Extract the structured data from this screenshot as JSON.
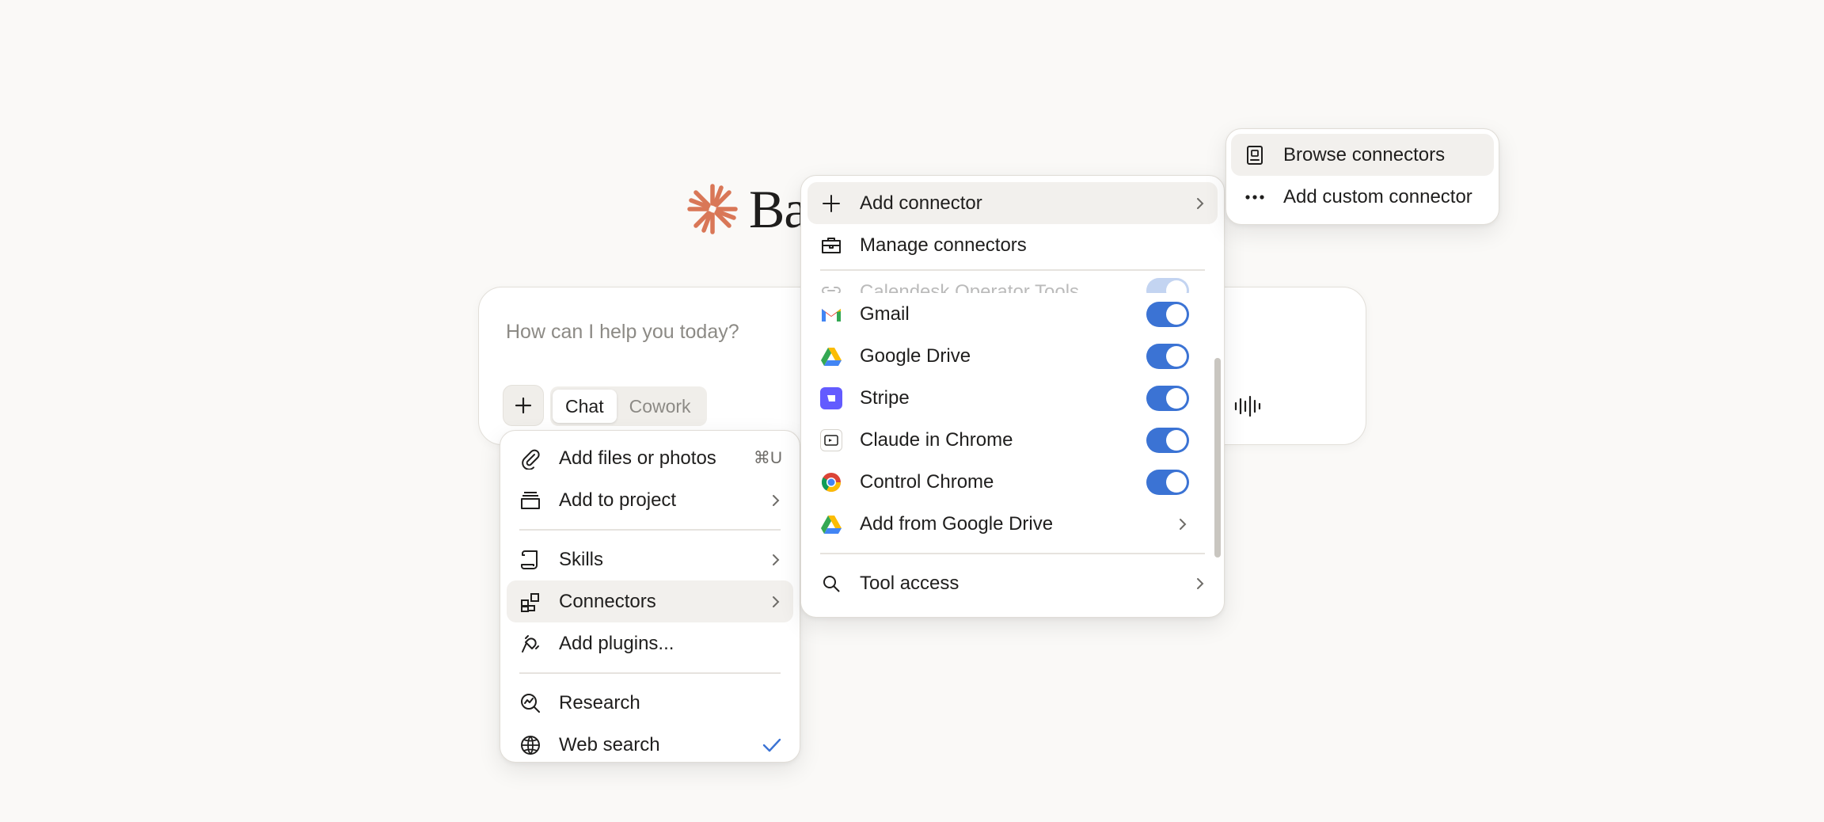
{
  "greeting": {
    "text": "Ba"
  },
  "composer": {
    "placeholder": "How can I help you today?",
    "modes": [
      "Chat",
      "Cowork"
    ]
  },
  "main_menu": {
    "items": [
      {
        "label": "Add files or photos",
        "shortcut": "⌘U",
        "icon": "paperclip-icon"
      },
      {
        "label": "Add to project",
        "icon": "project-box-icon"
      },
      {
        "label": "Skills",
        "icon": "scroll-icon"
      },
      {
        "label": "Connectors",
        "icon": "connectors-grid-icon"
      },
      {
        "label": "Add plugins...",
        "icon": "plug-icon"
      },
      {
        "label": "Research",
        "icon": "research-icon"
      },
      {
        "label": "Web search",
        "icon": "globe-icon"
      }
    ]
  },
  "connectors_menu": {
    "add_connector": "Add connector",
    "manage_connectors": "Manage connectors",
    "partial_item": "Calendesk Operator Tools",
    "items": [
      {
        "label": "Gmail",
        "enabled": true
      },
      {
        "label": "Google Drive",
        "enabled": true
      },
      {
        "label": "Stripe",
        "enabled": true
      },
      {
        "label": "Claude in Chrome",
        "enabled": true
      },
      {
        "label": "Control Chrome",
        "enabled": true
      }
    ],
    "add_from_drive": "Add from Google Drive",
    "tool_access": "Tool access"
  },
  "add_connector_menu": {
    "items": [
      "Browse connectors",
      "Add custom connector"
    ]
  },
  "colors": {
    "accent": "#3b73d4",
    "logo": "#d97757",
    "stripe": "#635bff"
  }
}
